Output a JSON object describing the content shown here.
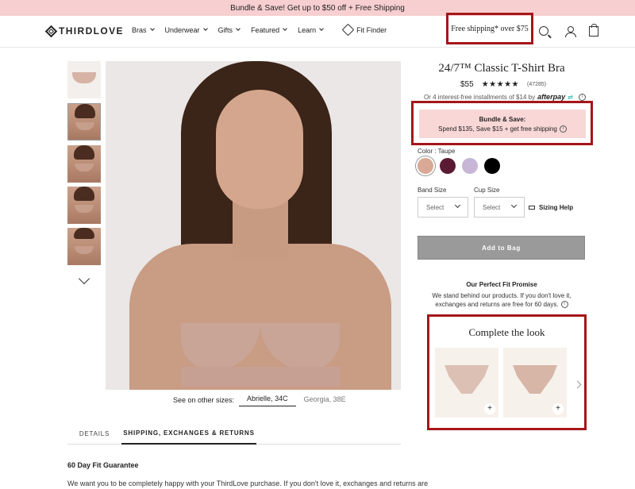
{
  "promo_banner": "Bundle & Save! Get up to $50 off + Free Shipping",
  "header": {
    "logo": "THIRDLOVE",
    "nav": [
      {
        "label": "Bras"
      },
      {
        "label": "Underwear"
      },
      {
        "label": "Gifts"
      },
      {
        "label": "Featured"
      },
      {
        "label": "Learn"
      }
    ],
    "fit_finder": "Fit Finder",
    "free_shipping": "Free shipping* over $75",
    "icons": [
      "search-icon",
      "user-icon",
      "bag-icon"
    ]
  },
  "gallery": {
    "thumbnails": 5,
    "see_other_sizes": "See on other sizes:",
    "sizes": [
      {
        "label": "Abrielle, 34C",
        "active": true
      },
      {
        "label": "Georgia, 38E",
        "active": false
      }
    ]
  },
  "tabs": [
    {
      "label": "DETAILS"
    },
    {
      "label": "SHIPPING, EXCHANGES & RETURNS"
    }
  ],
  "details": {
    "heading": "60 Day Fit Guarantee",
    "text": "We want you to be completely happy with your ThirdLove purchase. If you don't love it, exchanges and returns are"
  },
  "product": {
    "title": "24/7™ Classic T-Shirt Bra",
    "price": "$55",
    "stars": "★★★★★",
    "reviews": "(47285)",
    "installments": "Or 4 interest-free installments of $14 by",
    "afterpay": "afterpay",
    "bundle_title": "Bundle & Save:",
    "bundle_desc": "Spend $135, Save $15 + get free shipping",
    "color_label": "Color : Taupe",
    "swatches": [
      "#d9a996",
      "#5a1a33",
      "#c7b6d6",
      "#000000"
    ],
    "band_label": "Band Size",
    "cup_label": "Cup Size",
    "band_placeholder": "Select",
    "cup_placeholder": "Select",
    "sizing_help": "Sizing Help",
    "add_to_bag": "Add to Bag"
  },
  "promise": {
    "title": "Our Perfect Fit Promise",
    "line1": "We stand behind our products. If you don't love it,",
    "line2": "exchanges and returns are free for 60 days."
  },
  "complete_look": {
    "title": "Complete the look",
    "items": [
      {
        "plus": "+"
      },
      {
        "plus": "+"
      }
    ]
  },
  "colors": {
    "promo_bg": "#f7cfd0",
    "highlight_border": "#a4161a",
    "bundle_bg": "#f8d7d6",
    "add_to_bag_bg": "#9a9a9a"
  }
}
